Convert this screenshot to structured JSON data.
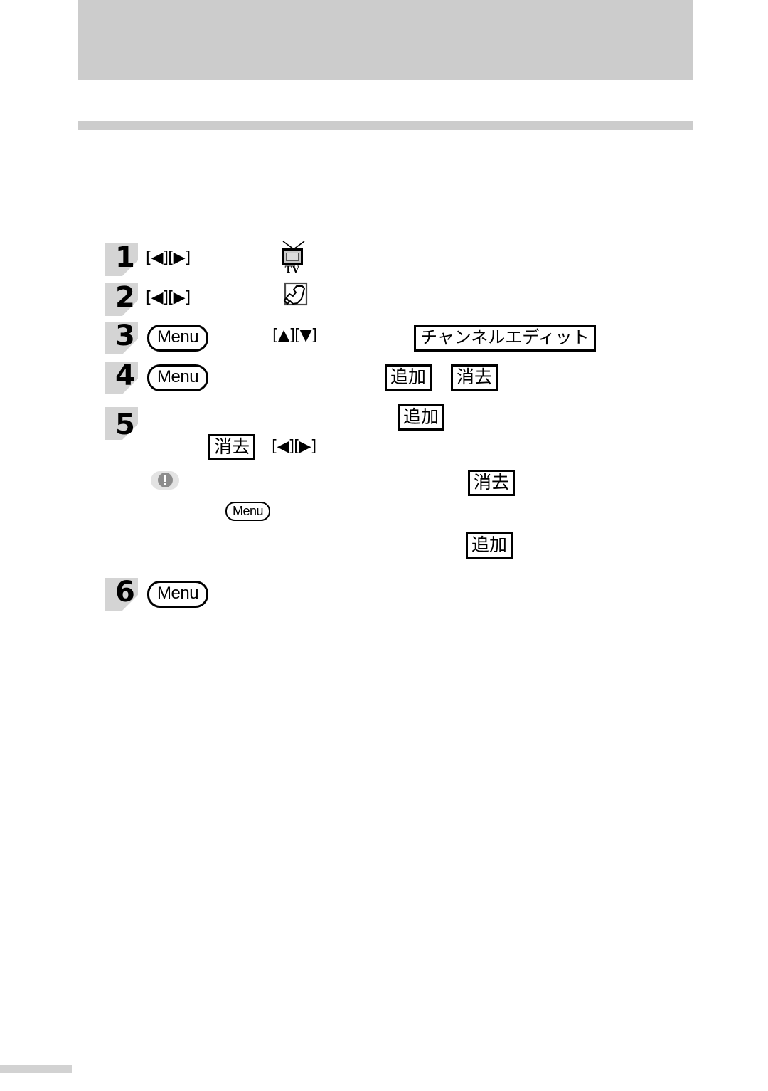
{
  "page": {
    "header_band_color": "#cccccc",
    "rule_color": "#cccccc",
    "footer_tab_color": "#d2d2d2"
  },
  "tokens": {
    "menu_label": "Menu",
    "keys_left_right": "[◀][▶]",
    "keys_up_down": "[▲][▼]",
    "channel_edit": "チャンネルエディット",
    "add": "追加",
    "delete": "消去",
    "tv_label": "TV"
  },
  "steps": [
    {
      "number": "1",
      "keys": "[◀][▶]",
      "icon": "tv-icon",
      "icon_label": "TV"
    },
    {
      "number": "2",
      "keys": "[◀][▶]",
      "icon": "wrench-icon"
    },
    {
      "number": "3",
      "button": "Menu",
      "keys": "[▲][▼]",
      "box": "チャンネルエディット"
    },
    {
      "number": "4",
      "button": "Menu",
      "box_a": "追加",
      "box_b": "消去"
    },
    {
      "number": "5",
      "box_add": "追加",
      "box_delete": "消去",
      "keys": "[◀][▶]"
    },
    {
      "number": "6",
      "button": "Menu"
    }
  ],
  "note": {
    "icon": "caution-icon",
    "box_delete": "消去",
    "button": "Menu",
    "box_add": "追加"
  }
}
